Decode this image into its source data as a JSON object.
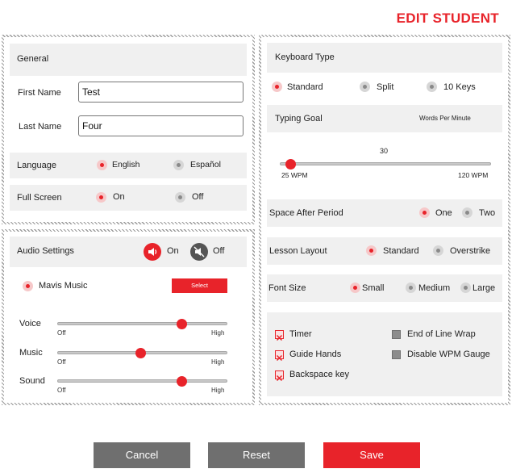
{
  "header": {
    "title": "EDIT STUDENT"
  },
  "general": {
    "section_title": "General",
    "first_name": {
      "label": "First Name",
      "value": "Test"
    },
    "last_name": {
      "label": "Last Name",
      "value": "Four"
    },
    "language": {
      "label": "Language",
      "options": [
        "English",
        "Español"
      ],
      "selected": "English"
    },
    "full_screen": {
      "label": "Full Screen",
      "options": [
        "On",
        "Off"
      ],
      "selected": "On"
    }
  },
  "audio": {
    "section_title": "Audio Settings",
    "on_label": "On",
    "off_label": "Off",
    "selected": "On",
    "music_option": "Mavis Music",
    "select_label": "Select",
    "sliders": [
      {
        "label": "Voice",
        "min_label": "Off",
        "max_label": "High",
        "level": 0.73
      },
      {
        "label": "Music",
        "min_label": "Off",
        "max_label": "High",
        "level": 0.49
      },
      {
        "label": "Sound",
        "min_label": "Off",
        "max_label": "High",
        "level": 0.73
      }
    ]
  },
  "keyboard": {
    "section_title": "Keyboard Type",
    "options": [
      "Standard",
      "Split",
      "10 Keys"
    ],
    "selected": "Standard"
  },
  "typing_goal": {
    "label": "Typing Goal",
    "unit": "Words Per Minute",
    "value": "30",
    "min_label": "25 WPM",
    "max_label": "120 WPM",
    "level": 0.05
  },
  "space_after_period": {
    "label": "Space After Period",
    "options": [
      "One",
      "Two"
    ],
    "selected": "One"
  },
  "lesson_layout": {
    "label": "Lesson Layout",
    "options": [
      "Standard",
      "Overstrike"
    ],
    "selected": "Standard"
  },
  "font_size": {
    "label": "Font Size",
    "options": [
      "Small",
      "Medium",
      "Large"
    ],
    "selected": "Small"
  },
  "checkboxes": [
    {
      "label": "Timer",
      "checked": true
    },
    {
      "label": "Guide Hands",
      "checked": true
    },
    {
      "label": "Backspace key",
      "checked": true
    },
    {
      "label": "End of Line Wrap",
      "checked": false
    },
    {
      "label": "Disable WPM Gauge",
      "checked": false
    }
  ],
  "buttons": {
    "cancel": "Cancel",
    "reset": "Reset",
    "save": "Save"
  },
  "colors": {
    "accent": "#e8232a",
    "button_grey": "#6f6f6f",
    "band": "#f0f0f0"
  }
}
